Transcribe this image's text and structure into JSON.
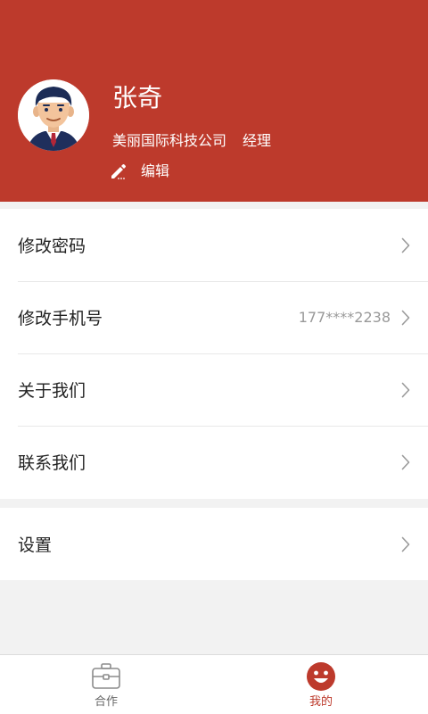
{
  "colors": {
    "primary": "#bd3a2c",
    "background": "#f2f2f2",
    "text": "#222222",
    "secondary_text": "#999999"
  },
  "profile": {
    "name": "张奇",
    "company": "美丽国际科技公司",
    "job_title": "经理",
    "edit_label": "编辑",
    "edit_icon": "pencil-icon",
    "avatar_icon": "businessman-avatar"
  },
  "menu": {
    "change_password": "修改密码",
    "change_phone": "修改手机号",
    "phone_value": "177****2238",
    "about_us": "关于我们",
    "contact_us": "联系我们",
    "settings": "设置"
  },
  "tabs": {
    "cooperation": {
      "label": "合作",
      "icon": "briefcase-icon",
      "active": false
    },
    "mine": {
      "label": "我的",
      "icon": "smiley-icon",
      "active": true
    }
  }
}
